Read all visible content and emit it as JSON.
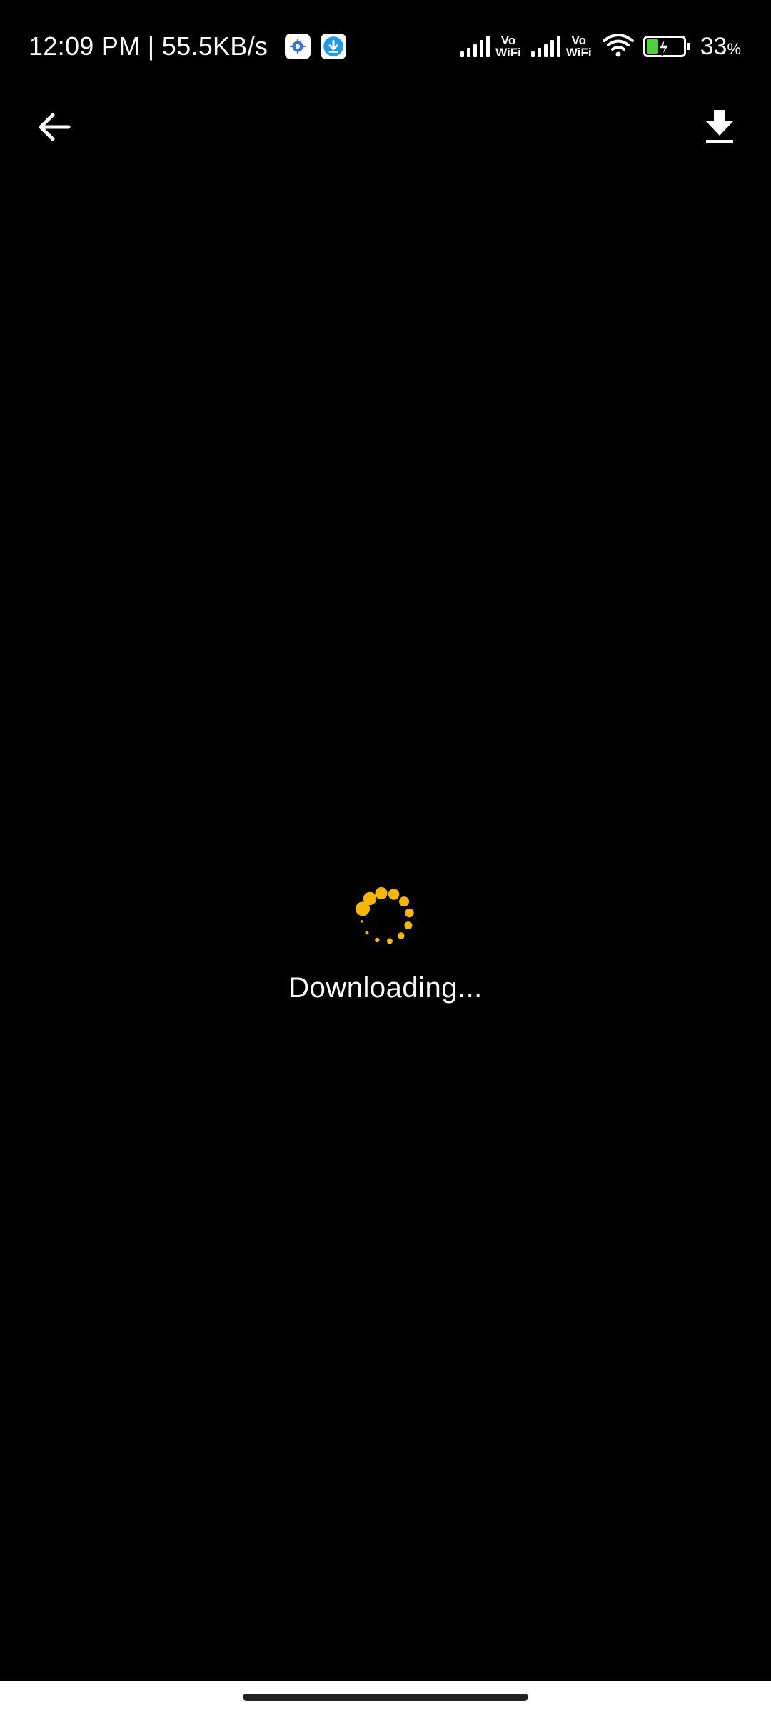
{
  "status_bar": {
    "time_speed": "12:09 PM | 55.5KB/s",
    "notif_icons": [
      "gear-icon",
      "download-circle-icon"
    ],
    "vowifi_top": "Vo",
    "vowifi_bottom": "WiFi",
    "battery_level": 33,
    "battery_number": "33",
    "battery_unit": "%",
    "battery_color": "#4cd137"
  },
  "toolbar": {
    "back_icon": "arrow-left-icon",
    "download_icon": "download-icon"
  },
  "loader": {
    "accent_color": "#f5b800",
    "label": "Downloading..."
  }
}
